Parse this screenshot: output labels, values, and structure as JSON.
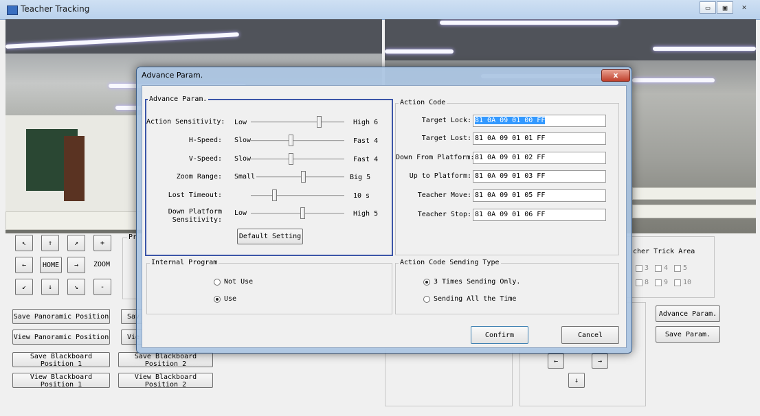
{
  "window": {
    "title": "Teacher Tracking"
  },
  "main": {
    "arrows": [
      "↖",
      "↑",
      "↗",
      "+",
      "←",
      "HOME",
      "→",
      "ZOOM",
      "↙",
      "↓",
      "↘",
      "-"
    ],
    "preset_label": "Pr",
    "buttons": {
      "save_panoramic": "Save Panoramic Position",
      "view_panoramic": "View Panoramic Position",
      "save_blackboard_1": "Save Blackboard Position 1",
      "view_blackboard_1": "View Blackboard Position 1",
      "save_blackboard_2": "Save Blackboard Position 2",
      "view_blackboard_2": "View Blackboard Position 2",
      "save_partial": "Sav",
      "view_partial": "Vie",
      "advance_param": "Advance Param.",
      "save_param": "Save Param."
    },
    "trick_area": {
      "label": "cher Trick Area",
      "checkboxes": [
        "3",
        "4",
        "5",
        "8",
        "9",
        "10"
      ]
    },
    "pan_arrows": [
      "←",
      "→",
      "↓"
    ]
  },
  "dialog": {
    "title": "Advance Param.",
    "close_label": "x",
    "advance_group": {
      "label": "Advance Param.",
      "sliders": [
        {
          "label": "Action Sensitivity:",
          "low": "Low",
          "high": "High 6",
          "position": 0.73
        },
        {
          "label": "H-Speed:",
          "low": "Slow",
          "high": "Fast 4",
          "position": 0.43
        },
        {
          "label": "V-Speed:",
          "low": "Slow",
          "high": "Fast 4",
          "position": 0.43
        },
        {
          "label": "Zoom Range:",
          "low": "Small",
          "high": "Big 5",
          "position": 0.53
        },
        {
          "label": "Lost Timeout:",
          "low": "",
          "high": "10 s",
          "position": 0.25
        },
        {
          "label": "Down Platform\nSensitivity:",
          "low": "Low",
          "high": "High 5",
          "position": 0.55
        }
      ],
      "default_button": "Default Setting"
    },
    "action_code": {
      "label": "Action Code",
      "rows": [
        {
          "label": "Target Lock:",
          "value": "81 0A 09 01 00 FF"
        },
        {
          "label": "Target Lost:",
          "value": "81 0A 09 01 01 FF"
        },
        {
          "label": "Down From Platform:",
          "value": "81 0A 09 01 02 FF"
        },
        {
          "label": "Up to Platform:",
          "value": "81 0A 09 01 03 FF"
        },
        {
          "label": "Teacher Move:",
          "value": "81 0A 09 01 05 FF"
        },
        {
          "label": "Teacher Stop:",
          "value": "81 0A 09 01 06 FF"
        }
      ]
    },
    "internal_program": {
      "label": "Internal Program",
      "options": [
        "Not Use",
        "Use"
      ],
      "selected": "Use"
    },
    "sending_type": {
      "label": "Action Code Sending Type",
      "options": [
        "3 Times Sending Only.",
        "Sending All the Time"
      ],
      "selected": "3 Times Sending Only."
    },
    "confirm": "Confirm",
    "cancel": "Cancel"
  }
}
